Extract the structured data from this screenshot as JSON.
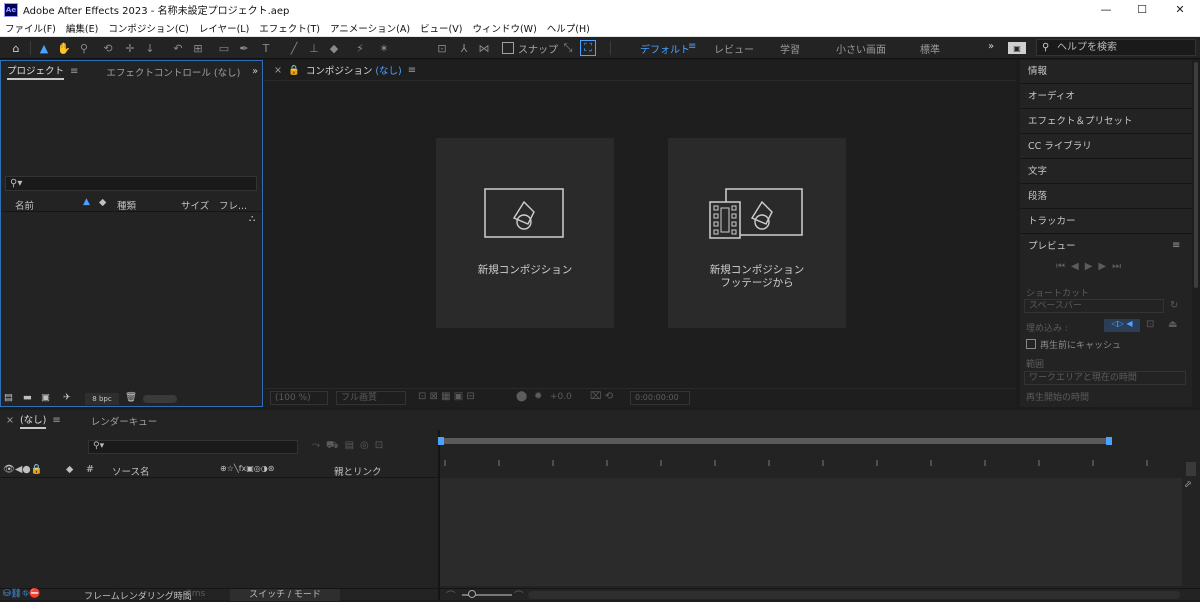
{
  "window": {
    "logo": "Ae",
    "title": "Adobe After Effects 2023 - 名称未設定プロジェクト.aep",
    "minimize": "—",
    "maximize": "☐",
    "close": "✕"
  },
  "menu": [
    "ファイル(F)",
    "編集(E)",
    "コンポジション(C)",
    "レイヤー(L)",
    "エフェクト(T)",
    "アニメーション(A)",
    "ビュー(V)",
    "ウィンドウ(W)",
    "ヘルプ(H)"
  ],
  "toolbar": {
    "snap_label": "スナップ",
    "workspaces": [
      "デフォルト",
      "レビュー",
      "学習",
      "小さい画面",
      "標準"
    ],
    "active_workspace": "デフォルト",
    "more": "»",
    "help_search_placeholder": "ヘルプを検索"
  },
  "project_panel": {
    "tabs": [
      "プロジェクト",
      "エフェクトコントロール (なし)"
    ],
    "more": "»",
    "search_placeholder": "",
    "columns": [
      "名前",
      "種類",
      "サイズ",
      "フレ..."
    ],
    "bpc": "8 bpc"
  },
  "composition_panel": {
    "tab_prefix": "コンポジション",
    "tab_name": "(なし)",
    "cards": [
      {
        "label": "新規コンポジション"
      },
      {
        "label_line1": "新規コンポジション",
        "label_line2": "フッテージから"
      }
    ],
    "footer": {
      "zoom": "(100 %)",
      "quality": "フル画質",
      "exposure": "+0.0",
      "timecode": "0:00:00:00"
    }
  },
  "right_panel": {
    "items": [
      "情報",
      "オーディオ",
      "エフェクト＆プリセット",
      "CC ライブラリ",
      "文字",
      "段落",
      "トラッカー"
    ],
    "preview": {
      "title": "プレビュー",
      "shortcut_label": "ショートカット",
      "shortcut_value": "スペースバー",
      "include_label": "埋め込み :",
      "cache_label": "再生前にキャッシュ",
      "range_label": "範囲",
      "range_value": "ワークエリアと現在の時間",
      "play_from_label": "再生開始の時間"
    }
  },
  "timeline": {
    "tabs": [
      "(なし)",
      "レンダーキュー"
    ],
    "columns": {
      "hash": "#",
      "source_name": "ソース名",
      "parent_link": "親とリンク"
    },
    "footer": {
      "frame_render_label": "フレームレンダリング時間",
      "frame_render_value": "0ms",
      "switch_mode": "スイッチ / モード"
    }
  },
  "colors": {
    "accent": "#4aa3ff",
    "panel_bg": "#232323",
    "app_bg": "#1c1c1c"
  }
}
